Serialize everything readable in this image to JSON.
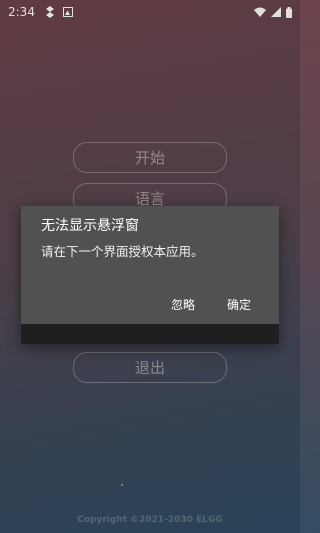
{
  "status_bar": {
    "time": "2:34",
    "left_icons": [
      "app-notification-icon",
      "image-notification-icon"
    ],
    "right_icons": [
      "wifi-icon",
      "signal-icon",
      "battery-icon"
    ]
  },
  "menu": {
    "start_label": "开始",
    "language_label": "语言",
    "exit_label": "退出"
  },
  "dialog": {
    "title": "无法显示悬浮窗",
    "message": "请在下一个界面授权本应用。",
    "ignore_label": "忽略",
    "confirm_label": "确定"
  },
  "footer": {
    "copyright": "Copyright ©2021-2030 ELGG"
  },
  "colors": {
    "background_top": "#6e444c",
    "background_bottom": "#2f4d66",
    "dialog_background": "#515151"
  }
}
